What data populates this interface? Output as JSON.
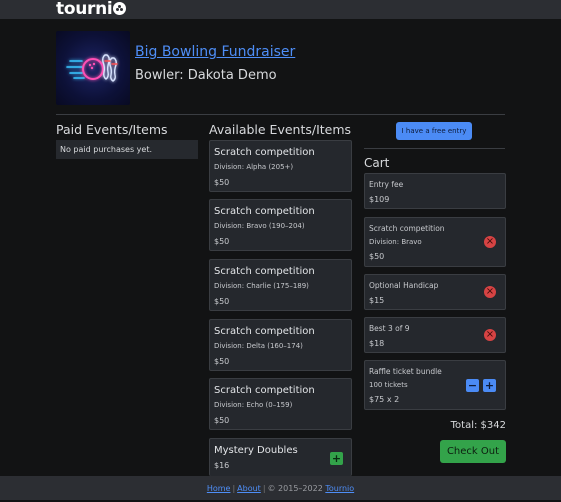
{
  "brand": {
    "name_prefix": "tourni"
  },
  "event": {
    "title": "Big Bowling Fundraiser",
    "bowler_line": "Bowler: Dakota Demo"
  },
  "paid": {
    "heading": "Paid Events/Items",
    "empty_text": "No paid purchases yet."
  },
  "available": {
    "heading": "Available Events/Items",
    "items": [
      {
        "title": "Scratch competition",
        "division": "Division: Alpha (205+)",
        "price": "$50"
      },
      {
        "title": "Scratch competition",
        "division": "Division: Bravo (190–204)",
        "price": "$50"
      },
      {
        "title": "Scratch competition",
        "division": "Division: Charlie (175–189)",
        "price": "$50"
      },
      {
        "title": "Scratch competition",
        "division": "Division: Delta (160–174)",
        "price": "$50"
      },
      {
        "title": "Scratch competition",
        "division": "Division: Echo (0–159)",
        "price": "$50"
      },
      {
        "title": "Mystery Doubles",
        "price": "$16",
        "add_label": "+"
      }
    ]
  },
  "free_entry": {
    "label": "I have a free entry"
  },
  "cart": {
    "heading": "Cart",
    "items": [
      {
        "title": "Entry fee",
        "price": "$109"
      },
      {
        "title": "Scratch competition",
        "division": "Division: Bravo",
        "price": "$50",
        "remove_label": "×"
      },
      {
        "title": "Optional Handicap",
        "price": "$15",
        "remove_label": "×"
      },
      {
        "title": "Best 3 of 9",
        "price": "$18",
        "remove_label": "×"
      },
      {
        "title": "Raffle ticket bundle",
        "detail": "100 tickets",
        "price": "$75 x 2",
        "minus_label": "−",
        "plus_label": "+"
      }
    ],
    "total": "Total: $342",
    "checkout_label": "Check Out"
  },
  "footer": {
    "home": "Home",
    "about": "About",
    "sep": "|",
    "copyright": "© 2015–2022",
    "brand_link": "Tournio"
  },
  "colors": {
    "accent_blue": "#4b8bf5",
    "green": "#33a34a",
    "red": "#d64343",
    "background": "#121314",
    "card": "#25282d"
  }
}
